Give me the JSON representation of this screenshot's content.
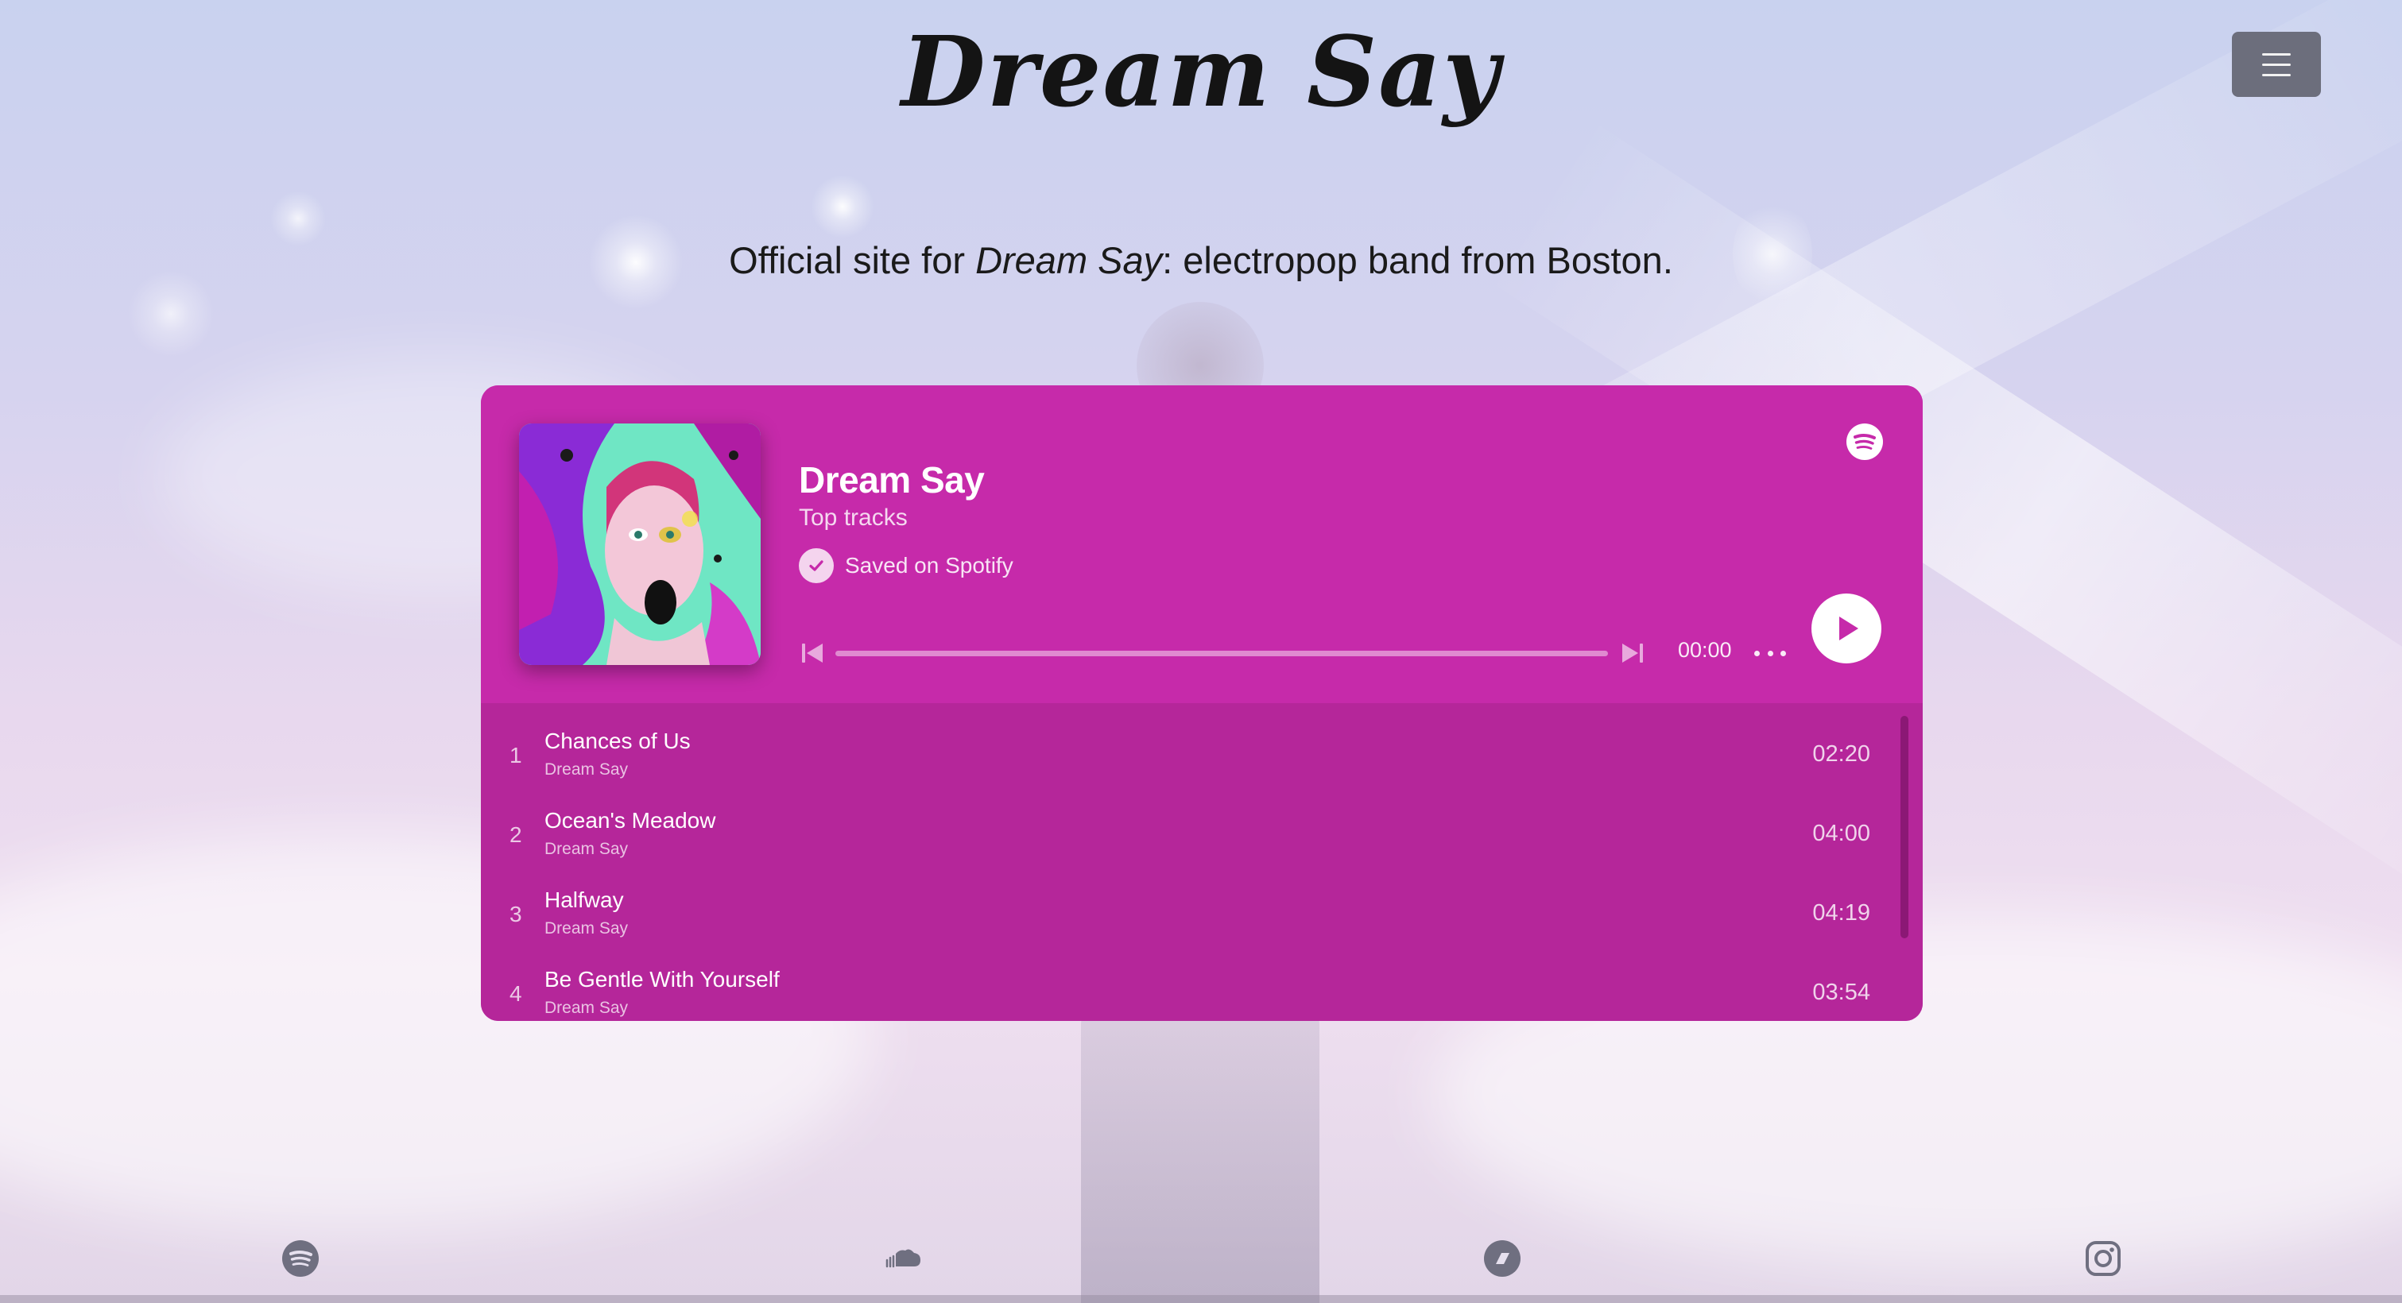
{
  "header": {
    "title": "Dream Say",
    "menu_icon": "hamburger-menu-icon"
  },
  "tagline": {
    "prefix": "Official site for ",
    "band": "Dream Say",
    "suffix": ": electropop band from Boston."
  },
  "player": {
    "title": "Dream Say",
    "subtitle": "Top tracks",
    "saved_label": "Saved on Spotify",
    "time": "00:00",
    "progress": 0,
    "accent_color": "#c62aaa",
    "list_color": "#b5269a",
    "tracks": [
      {
        "number": "1",
        "name": "Chances of Us",
        "artist": "Dream Say",
        "duration": "02:20"
      },
      {
        "number": "2",
        "name": "Ocean's Meadow",
        "artist": "Dream Say",
        "duration": "04:00"
      },
      {
        "number": "3",
        "name": "Halfway",
        "artist": "Dream Say",
        "duration": "04:19"
      },
      {
        "number": "4",
        "name": "Be Gentle With Yourself",
        "artist": "Dream Say",
        "duration": "03:54"
      }
    ]
  },
  "footer": {
    "icons": [
      "spotify-icon",
      "soundcloud-icon",
      "bandcamp-icon",
      "instagram-icon"
    ]
  }
}
